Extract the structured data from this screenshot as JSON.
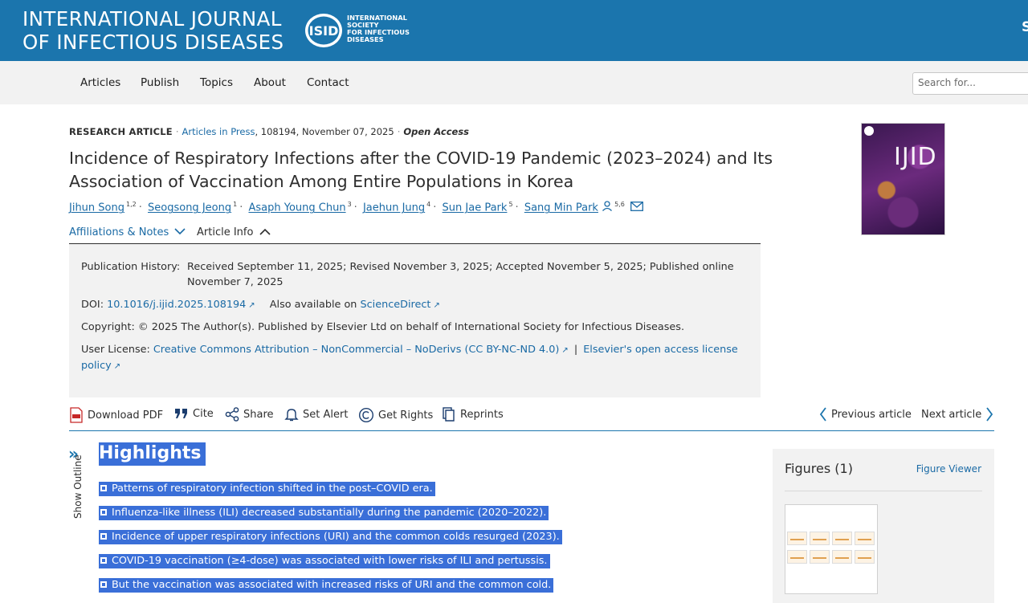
{
  "header": {
    "journal_line1": "INTERNATIONAL JOURNAL",
    "journal_line2": "OF INFECTIOUS DISEASES",
    "isid_logo_text": "ISID",
    "isid_line1": "INTERNATIONAL",
    "isid_line2": "SOCIETY",
    "isid_line3": "FOR INFECTIOUS",
    "isid_line4": "DISEASES",
    "cut_text": "S"
  },
  "nav": {
    "items": [
      {
        "label": "Articles"
      },
      {
        "label": "Publish"
      },
      {
        "label": "Topics"
      },
      {
        "label": "About"
      },
      {
        "label": "Contact"
      }
    ],
    "search_placeholder": "Search for..."
  },
  "article": {
    "type": "RESEARCH ARTICLE",
    "section_link": "Articles in Press",
    "meta_rest": ", 108194, November 07, 2025",
    "access": "Open Access",
    "title": "Incidence of Respiratory Infections after the COVID-19 Pandemic (2023–2024) and Its Association of Vaccination Among Entire Populations in Korea",
    "authors": [
      {
        "name": "Jihun Song",
        "sup": "1,2"
      },
      {
        "name": "Seogsong Jeong",
        "sup": "1"
      },
      {
        "name": "Asaph Young Chun",
        "sup": "3"
      },
      {
        "name": "Jaehun Jung",
        "sup": "4"
      },
      {
        "name": "Sun Jae Park",
        "sup": "5"
      },
      {
        "name": "Sang Min Park",
        "sup": "5,6"
      }
    ],
    "tabs": {
      "affiliations": "Affiliations & Notes",
      "article_info": "Article Info"
    },
    "cover_title": "IJID"
  },
  "info": {
    "history_label": "Publication History:",
    "history_line1": "Received September 11, 2025; Revised November 3, 2025; Accepted November 5, 2025; Published online",
    "history_line2": "November 7, 2025",
    "doi_label": "DOI:",
    "doi_value": "10.1016/j.ijid.2025.108194",
    "also_label": "Also available on",
    "also_link": "ScienceDirect",
    "copyright": "Copyright: © 2025 The Author(s). Published by Elsevier Ltd on behalf of International Society for Infectious Diseases.",
    "license_label": "User License:",
    "license_link": "Creative Commons Attribution – NonCommercial – NoDerivs (CC BY-NC-ND 4.0)",
    "license_sep": "|",
    "license_link2_a": "Elsevier's open access license",
    "license_link2_b": "policy"
  },
  "toolbar": {
    "download_pdf": "Download PDF",
    "cite": "Cite",
    "share": "Share",
    "set_alert": "Set Alert",
    "get_rights": "Get Rights",
    "reprints": "Reprints",
    "previous": "Previous article",
    "next": "Next article"
  },
  "outline": {
    "label": "Show Outline"
  },
  "highlights": {
    "heading": "Highlights",
    "items": [
      "Patterns of respiratory infection shifted in the post–COVID era.",
      "Influenza-like illness (ILI) decreased substantially during the pandemic (2020–2022).",
      "Incidence of upper respiratory infections (URI) and the common colds resurged (2023).",
      "COVID-19 vaccination (≥4-dose) was associated with lower risks of ILI and pertussis.",
      "But the vaccination was associated with increased risks of URI and the common cold."
    ]
  },
  "figures": {
    "title": "Figures (1)",
    "viewer": "Figure Viewer"
  }
}
